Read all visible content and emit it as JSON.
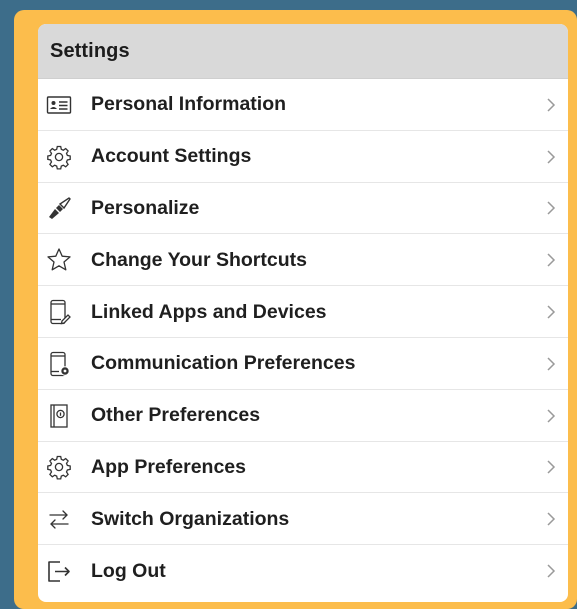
{
  "settings": {
    "title": "Settings",
    "items": [
      {
        "label": "Personal Information",
        "icon": "id-card-icon"
      },
      {
        "label": "Account Settings",
        "icon": "gear-icon"
      },
      {
        "label": "Personalize",
        "icon": "paintbrush-icon"
      },
      {
        "label": "Change Your Shortcuts",
        "icon": "star-icon"
      },
      {
        "label": "Linked Apps and Devices",
        "icon": "phone-link-icon"
      },
      {
        "label": "Communication Preferences",
        "icon": "phone-gear-icon"
      },
      {
        "label": "Other Preferences",
        "icon": "info-panel-icon"
      },
      {
        "label": "App Preferences",
        "icon": "gear-icon"
      },
      {
        "label": "Switch Organizations",
        "icon": "switch-arrows-icon"
      },
      {
        "label": "Log Out",
        "icon": "logout-icon"
      }
    ]
  },
  "colors": {
    "frame": "#fcbd4c",
    "background": "#3d6d8a",
    "header": "#d9d9d9"
  }
}
